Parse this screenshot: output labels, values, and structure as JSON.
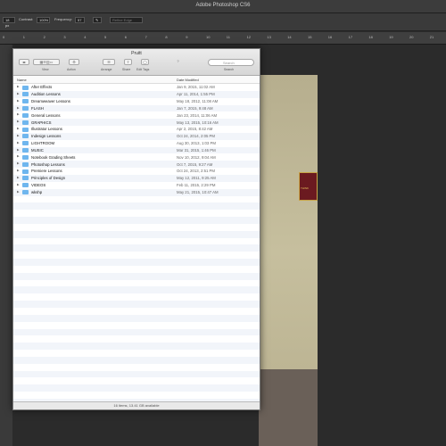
{
  "photoshop": {
    "title": "Adobe Photoshop CS6",
    "options": {
      "size": "18 px",
      "contrast_label": "Contrast:",
      "contrast": "100%",
      "frequency_label": "Frequency:",
      "frequency": "57",
      "refine": "Refine Edge"
    },
    "ruler": [
      "0",
      "1",
      "2",
      "3",
      "4",
      "5",
      "6",
      "7",
      "8",
      "9",
      "10",
      "11",
      "12",
      "13",
      "14",
      "15",
      "16",
      "17",
      "18",
      "19",
      "20",
      "21"
    ]
  },
  "finder": {
    "title": "Pruitt",
    "toolbar": {
      "view": "View",
      "action": "Action",
      "arrange": "Arrange",
      "share": "Share",
      "edit_tags": "Edit Tags",
      "search": "Search",
      "search_placeholder": "Search"
    },
    "headers": {
      "name": "Name",
      "date": "Date Modified"
    },
    "items": [
      {
        "name": "After Effects",
        "date": "Jan 9, 2015, 11:02 AM"
      },
      {
        "name": "Audition Lessons",
        "date": "Apr 11, 2014, 1:55 PM"
      },
      {
        "name": "Dreamweaver Lessons",
        "date": "May 18, 2012, 11:08 AM"
      },
      {
        "name": "FLASH",
        "date": "Jan 7, 2015, 9:48 AM"
      },
      {
        "name": "General Lessons",
        "date": "Jan 23, 2014, 11:06 AM"
      },
      {
        "name": "GRAPHICS",
        "date": "May 13, 2015, 10:16 AM"
      },
      {
        "name": "Illustrator Lessons",
        "date": "Apr 2, 2015, 8:42 AM"
      },
      {
        "name": "Indesign Lessons",
        "date": "Oct 24, 2014, 2:05 PM"
      },
      {
        "name": "LIGHTROOM",
        "date": "Aug 30, 2013, 1:03 PM"
      },
      {
        "name": "MUSIC",
        "date": "Mar 31, 2015, 1:46 PM"
      },
      {
        "name": "Notebook Grading Sheets",
        "date": "Nov 10, 2012, 9:04 AM"
      },
      {
        "name": "Photoshop Lessons",
        "date": "Oct 7, 2015, 9:27 AM"
      },
      {
        "name": "Premiere Lessons",
        "date": "Oct 24, 2013, 2:51 PM"
      },
      {
        "name": "Principles of Design",
        "date": "May 12, 2011, 9:25 AM"
      },
      {
        "name": "VIDEOS",
        "date": "Feb 11, 2015, 2:29 PM"
      },
      {
        "name": "wkshp",
        "date": "May 21, 2015, 10:47 AM"
      }
    ],
    "status": "16 items, 13.41 GB available"
  },
  "canvas": {
    "sign_text": "THINK"
  }
}
